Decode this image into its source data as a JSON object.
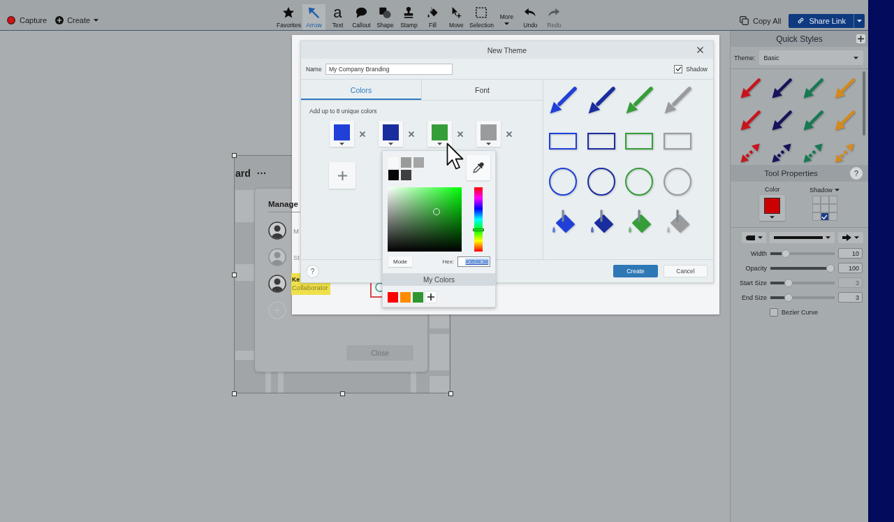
{
  "toolbar": {
    "capture": {
      "label": "Capture"
    },
    "create": {
      "label": "Create"
    },
    "tools": [
      {
        "kind": "favorites",
        "label": "Favorites",
        "selected": false,
        "disabled": false
      },
      {
        "kind": "arrow",
        "label": "Arrow",
        "selected": true,
        "disabled": false
      },
      {
        "kind": "text",
        "glyph": "a",
        "label": "Text",
        "selected": false,
        "disabled": false
      },
      {
        "kind": "callout",
        "label": "Callout",
        "selected": false,
        "disabled": false
      },
      {
        "kind": "shape",
        "label": "Shape",
        "selected": false,
        "disabled": false
      },
      {
        "kind": "stamp",
        "label": "Stamp",
        "selected": false,
        "disabled": false
      },
      {
        "kind": "fill",
        "label": "Fill",
        "selected": false,
        "disabled": false
      },
      {
        "kind": "move",
        "label": "Move",
        "selected": false,
        "disabled": false
      },
      {
        "kind": "selection",
        "label": "Selection",
        "selected": false,
        "disabled": false
      },
      {
        "kind": "more",
        "label": "More",
        "selected": false,
        "disabled": false
      },
      {
        "kind": "undo",
        "label": "Undo",
        "selected": false,
        "disabled": false
      },
      {
        "kind": "redo",
        "label": "Redo",
        "selected": false,
        "disabled": true
      }
    ],
    "copy_all": {
      "label": "Copy All"
    },
    "share_link": {
      "label": "Share Link"
    }
  },
  "canvas": {
    "image": {
      "title": "ard",
      "title_menu": "···",
      "panel": {
        "title": "Manage",
        "members": [
          {
            "kind": "member",
            "name": "M",
            "dimmed": false,
            "highlighted": false
          },
          {
            "kind": "member",
            "name": "St",
            "dimmed": true,
            "highlighted": false
          },
          {
            "kind": "member",
            "name": "Ke",
            "role": "Collaborator",
            "dimmed": false,
            "highlighted": true
          },
          {
            "kind": "add",
            "dimmed": true
          }
        ],
        "close_button": "Close"
      }
    }
  },
  "dialog": {
    "title": "New Theme",
    "name": {
      "label": "Name",
      "value": "My Company Branding"
    },
    "shadow": {
      "label": "Shadow",
      "checked": true
    },
    "tabs": [
      {
        "label": "Colors",
        "selected": true
      },
      {
        "label": "Font",
        "selected": false
      }
    ],
    "hint": "Add up to 8 unique colors",
    "colors": [
      {
        "color": "#2040d8"
      },
      {
        "color": "#1a2d9e"
      },
      {
        "color": "#359e38"
      },
      {
        "color": "#9a9b9d"
      }
    ],
    "help": "?",
    "buttons": [
      {
        "kind": "primary",
        "label": "Create"
      },
      {
        "kind": "secondary",
        "label": "Cancel"
      }
    ]
  },
  "color_picker": {
    "presets": [
      {
        "color": "#f8f8f8"
      },
      {
        "color": "#9a9a9a"
      },
      {
        "color": "#a5a5a5"
      },
      {
        "color": "#050505"
      },
      {
        "color": "#3d3f40"
      }
    ],
    "mode_button": "Mode",
    "hex_label": "Hex:",
    "hex": {
      "value": "#359E38",
      "selected": true
    },
    "my_colors_title": "My Colors",
    "my_colors": [
      {
        "color": "#ff0000"
      },
      {
        "color": "#ff8c00"
      },
      {
        "color": "#2e9630"
      }
    ]
  },
  "quick_styles": {
    "title": "Quick Styles",
    "theme": {
      "label": "Theme:",
      "value": "Basic"
    },
    "styles": [
      {
        "kind": "arrow",
        "color": "#c8141c"
      },
      {
        "kind": "arrow",
        "color": "#15135a"
      },
      {
        "kind": "arrow",
        "color": "#167a50"
      },
      {
        "kind": "arrow",
        "color": "#d48a1e"
      },
      {
        "kind": "arrow",
        "color": "#c8141c"
      },
      {
        "kind": "arrow",
        "color": "#15135a"
      },
      {
        "kind": "arrow",
        "color": "#167a50"
      },
      {
        "kind": "arrow",
        "color": "#d48a1e"
      },
      {
        "kind": "double-arrow",
        "color": "#c8141c"
      },
      {
        "kind": "double-arrow",
        "color": "#15135a"
      },
      {
        "kind": "double-arrow",
        "color": "#167a50"
      },
      {
        "kind": "double-arrow",
        "color": "#d48a1e"
      }
    ]
  },
  "tool_properties": {
    "title": "Tool Properties",
    "help": "?",
    "color": {
      "label": "Color",
      "color": "#cc0000"
    },
    "shadow": {
      "label": "Shadow",
      "cells": [
        {
          "checked": false
        },
        {
          "checked": false
        },
        {
          "checked": false
        },
        {
          "checked": false
        },
        {
          "checked": false
        },
        {
          "checked": false
        },
        {
          "checked": false
        },
        {
          "checked": true
        },
        {
          "checked": false
        }
      ]
    },
    "sliders": [
      {
        "label": "Width",
        "level": 0.2,
        "value": "10",
        "disabled": false
      },
      {
        "label": "Opacity",
        "level": 1,
        "value": "100",
        "disabled": false
      },
      {
        "label": "Start Size",
        "level": 0.25,
        "value": "3",
        "disabled": true
      },
      {
        "label": "End Size",
        "level": 0.25,
        "value": "3",
        "disabled": false
      }
    ],
    "bezier": {
      "label": "Bezier Curve",
      "checked": false
    }
  }
}
